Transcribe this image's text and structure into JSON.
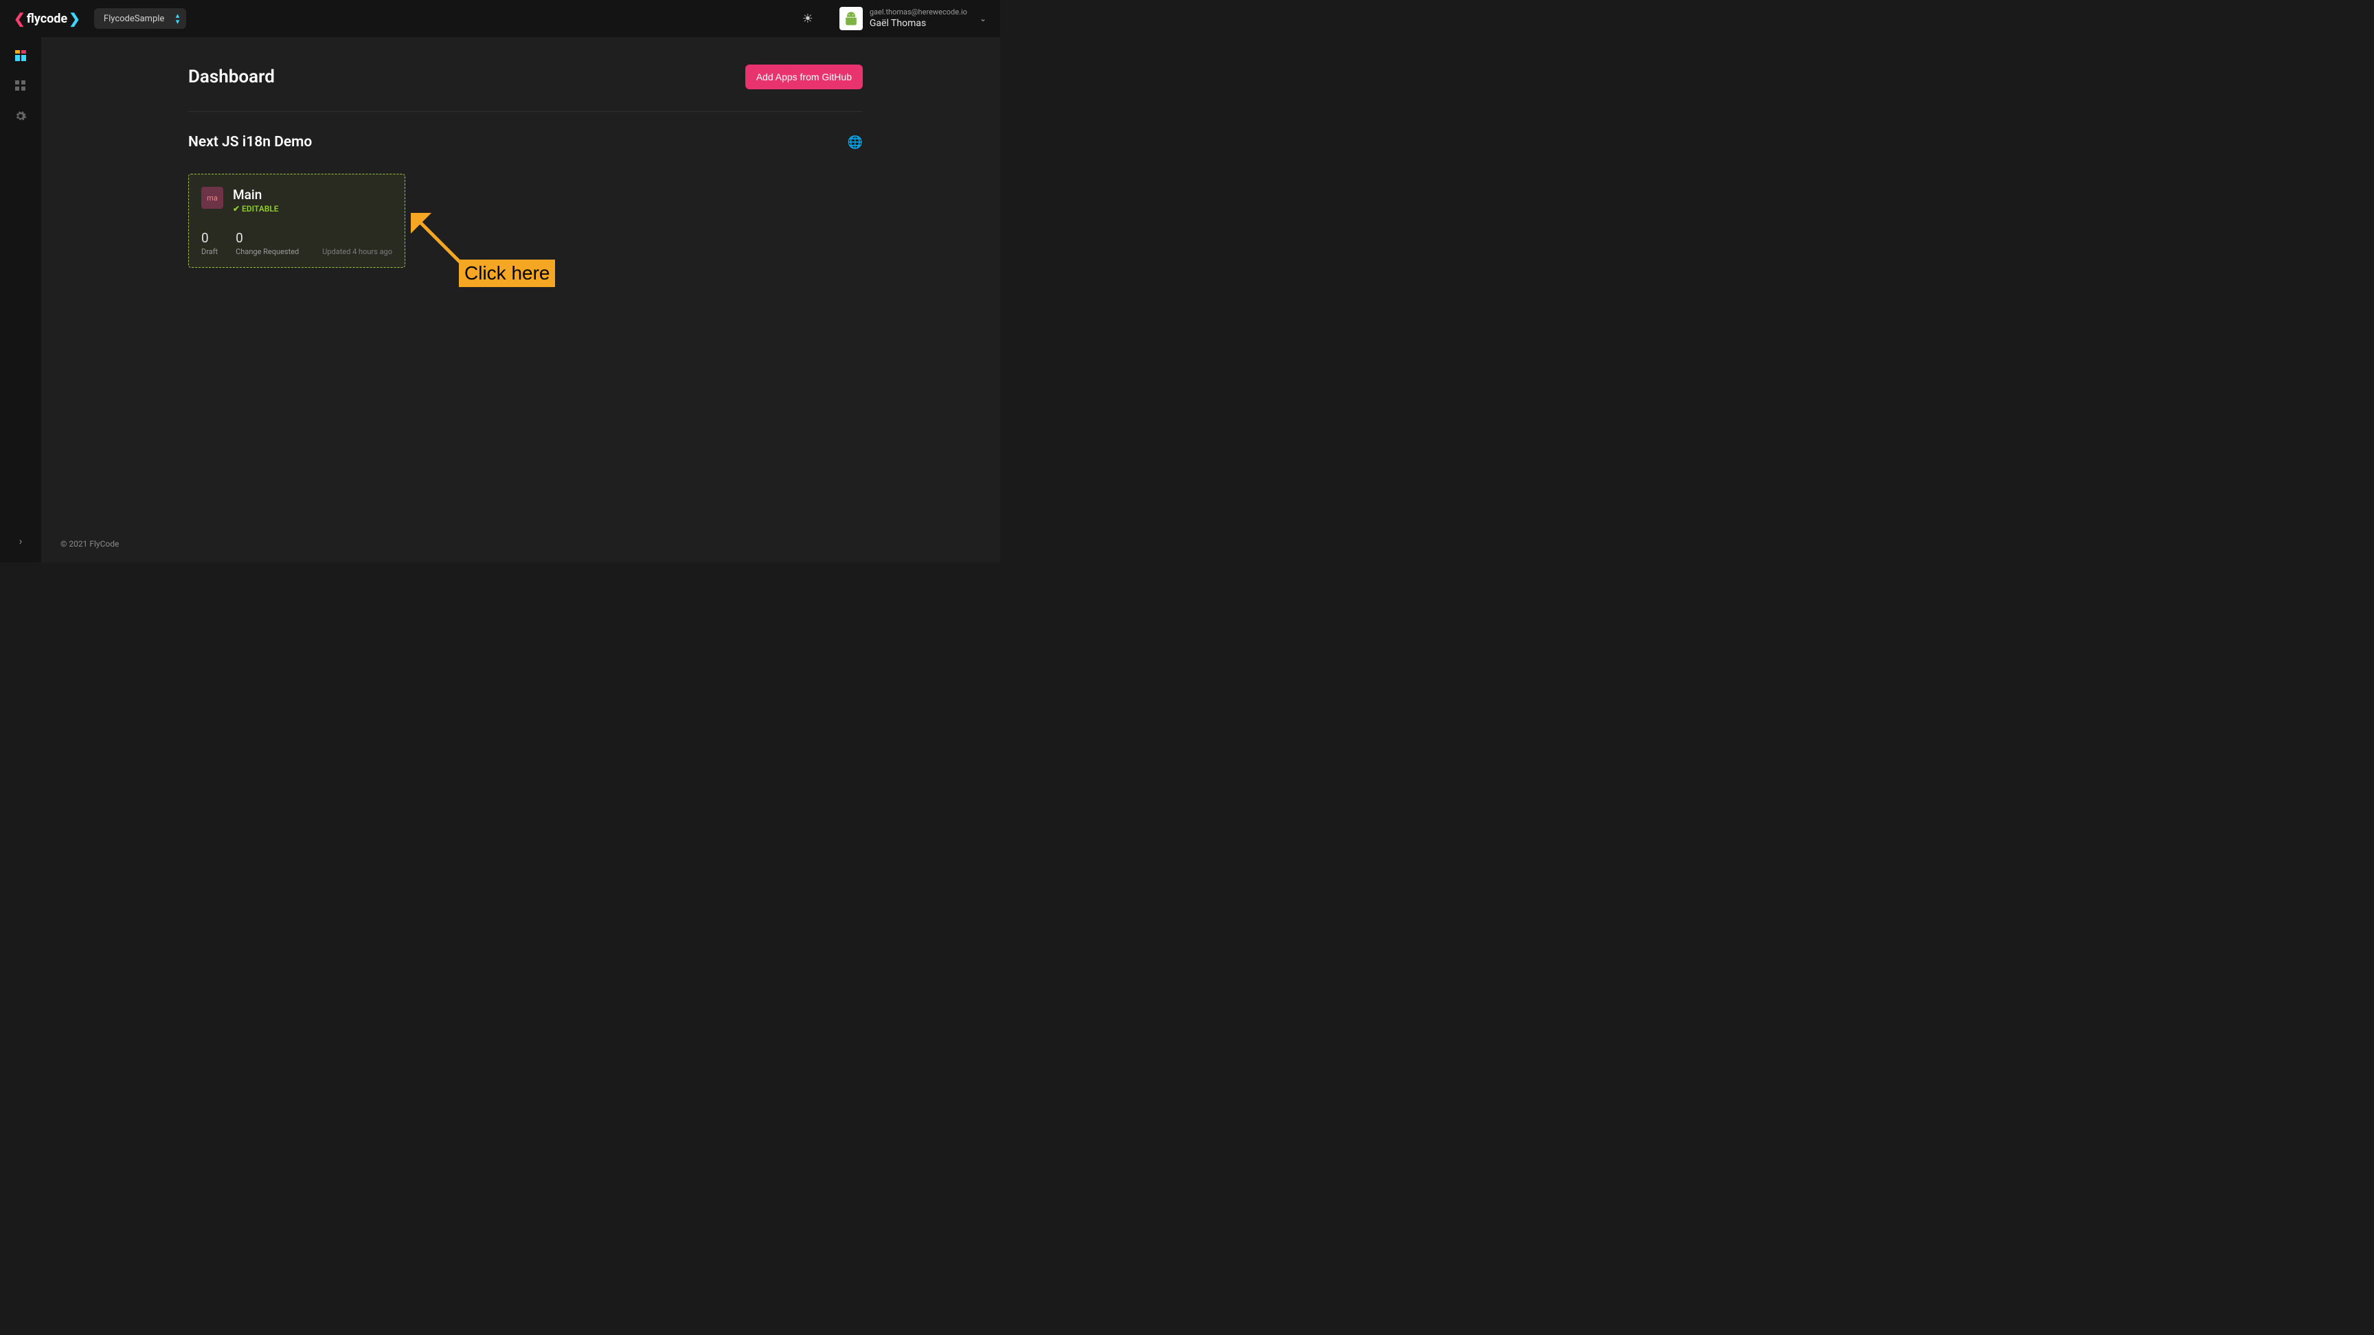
{
  "brand": "flycode",
  "project_selector": {
    "selected": "FlycodeSample"
  },
  "user": {
    "email": "gael.thomas@herewecode.io",
    "name": "Gaël Thomas"
  },
  "page": {
    "title": "Dashboard",
    "add_button": "Add Apps from GitHub"
  },
  "project": {
    "name": "Next JS i18n Demo"
  },
  "card": {
    "avatar_text": "ma",
    "title": "Main",
    "editable_label": "✔ EDITABLE",
    "stats": [
      {
        "value": "0",
        "label": "Draft"
      },
      {
        "value": "0",
        "label": "Change Requested"
      }
    ],
    "updated": "Updated 4 hours ago"
  },
  "footer": "© 2021 FlyCode",
  "annotation": {
    "label": "Click here"
  }
}
